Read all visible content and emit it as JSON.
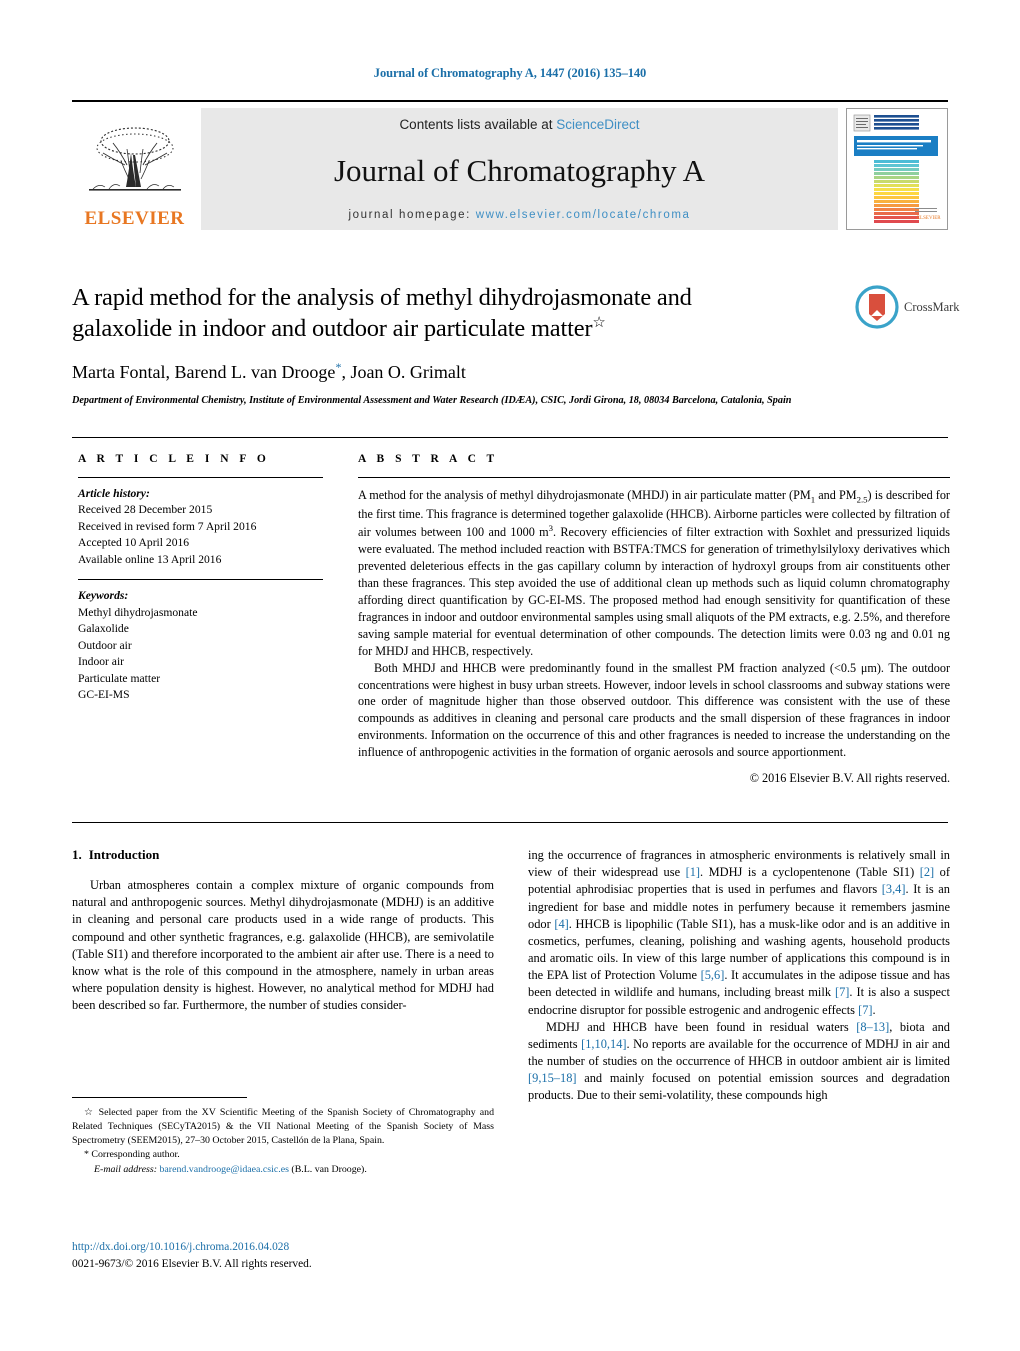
{
  "running_head": "Journal of Chromatography A, 1447 (2016) 135–140",
  "masthead": {
    "contents_prefix": "Contents lists available at ",
    "contents_link": "ScienceDirect",
    "journal_title": "Journal of Chromatography A",
    "homepage_prefix": "journal homepage:",
    "homepage_url": "www.elsevier.com/locate/chroma",
    "publisher": "ELSEVIER",
    "cover_title": "JOURNAL OF CHROMATOGRAPHY A",
    "accent_blue": "#1b6fa8",
    "link_blue": "#3f8fc4",
    "elsevier_orange": "#e87722"
  },
  "article": {
    "title": "A rapid method for the analysis of methyl dihydrojasmonate and galaxolide in indoor and outdoor air particulate matter",
    "title_marker": "☆",
    "authors_pre": "Marta Fontal, Barend L. van Drooge",
    "authors_marker": "*",
    "authors_post": ", Joan O. Grimalt",
    "affiliation": "Department of Environmental Chemistry, Institute of Environmental Assessment and Water Research (IDÆA), CSIC, Jordi Girona, 18, 08034 Barcelona, Catalonia, Spain",
    "crossmark_label": "CrossMark"
  },
  "article_info": {
    "heading": "A R T I C L E  I N F O",
    "history_label": "Article history:",
    "history": [
      "Received 28 December 2015",
      "Received in revised form 7 April 2016",
      "Accepted 10 April 2016",
      "Available online 13 April 2016"
    ],
    "keywords_label": "Keywords:",
    "keywords": [
      "Methyl dihydrojasmonate",
      "Galaxolide",
      "Outdoor air",
      "Indoor air",
      "Particulate matter",
      "GC-EI-MS"
    ]
  },
  "abstract": {
    "heading": "A B S T R A C T",
    "paragraph1_a": "A method for the analysis of methyl dihydrojasmonate (MHDJ) in air particulate matter (PM",
    "paragraph1_sub1": "1",
    "paragraph1_b": " and PM",
    "paragraph1_sub2": "2.5",
    "paragraph1_c": ") is described for the first time. This fragrance is determined together galaxolide (HHCB). Airborne particles were collected by filtration of air volumes between 100 and 1000 m",
    "paragraph1_sup": "3",
    "paragraph1_d": ". Recovery efficiencies of filter extraction with Soxhlet and pressurized liquids were evaluated. The method included reaction with BSTFA:TMCS for generation of trimethylsilyloxy derivatives which prevented deleterious effects in the gas capillary column by interaction of hydroxyl groups from air constituents other than these fragrances. This step avoided the use of additional clean up methods such as liquid column chromatography affording direct quantification by GC-EI-MS. The proposed method had enough sensitivity for quantification of these fragrances in indoor and outdoor environmental samples using small aliquots of the PM extracts, e.g. 2.5%, and therefore saving sample material for eventual determination of other compounds. The detection limits were 0.03 ng and 0.01 ng for MHDJ and HHCB, respectively.",
    "paragraph2_a": "Both MHDJ and HHCB were predominantly found in the smallest PM fraction analyzed (<0.5 ",
    "paragraph2_mu": "μm",
    "paragraph2_b": "). The outdoor concentrations were highest in busy urban streets. However, indoor levels in school classrooms and subway stations were one order of magnitude higher than those observed outdoor. This difference was consistent with the use of these compounds as additives in cleaning and personal care products and the small dispersion of these fragrances in indoor environments. Information on the occurrence of this and other fragrances is needed to increase the understanding on the influence of anthropogenic activities in the formation of organic aerosols and source apportionment.",
    "copyright": "© 2016 Elsevier B.V. All rights reserved."
  },
  "introduction": {
    "number": "1.",
    "heading": "Introduction",
    "left_paragraph": "Urban atmospheres contain a complex mixture of organic compounds from natural and anthropogenic sources. Methyl dihydrojasmonate (MDHJ) is an additive in cleaning and personal care products used in a wide range of products. This compound and other synthetic fragrances, e.g. galaxolide (HHCB), are semivolatile (Table SI1) and therefore incorporated to the ambient air after use. There is a need to know what is the role of this compound in the atmosphere, namely in urban areas where population density is highest. However, no analytical method for MDHJ had been described so far. Furthermore, the number of studies consider-",
    "right_p1_a": "ing the occurrence of fragrances in atmospheric environments is relatively small in view of their widespread use ",
    "right_p1_r1": "[1]",
    "right_p1_b": ". MDHJ is a cyclopentenone (Table SI1) ",
    "right_p1_r2": "[2]",
    "right_p1_c": " of potential aphrodisiac properties that is used in perfumes and flavors ",
    "right_p1_r3": "[3,4]",
    "right_p1_d": ". It is an ingredient for base and middle notes in perfumery because it remembers jasmine odor ",
    "right_p1_r4": "[4]",
    "right_p1_e": ". HHCB is lipophilic (Table SI1), has a musk-like odor and is an additive in cosmetics, perfumes, cleaning, polishing and washing agents, household products and aromatic oils. In view of this large number of applications this compound is in the EPA list of Protection Volume ",
    "right_p1_r5": "[5,6]",
    "right_p1_f": ". It accumulates in the adipose tissue and has been detected in wildlife and humans, including breast milk ",
    "right_p1_r6": "[7]",
    "right_p1_g": ". It is also a suspect endocrine disruptor for possible estrogenic and androgenic effects ",
    "right_p1_r7": "[7]",
    "right_p1_h": ".",
    "right_p2_a": "MDHJ and HHCB have been found in residual waters ",
    "right_p2_r1": "[8–13]",
    "right_p2_b": ", biota and sediments ",
    "right_p2_r2": "[1,10,14]",
    "right_p2_c": ". No reports are available for the occurrence of MDHJ in air and the number of studies on the occurrence of HHCB in outdoor ambient air is limited ",
    "right_p2_r3": "[9,15–18]",
    "right_p2_d": " and mainly focused on potential emission sources and degradation products. Due to their semi-volatility, these compounds high"
  },
  "footnotes": {
    "marker": "☆",
    "conference_note": " Selected paper from the XV Scientific Meeting of the Spanish Society of Chromatography and Related Techniques (SECyTA2015) & the VII National Meeting of the Spanish Society of Mass Spectrometry (SEEM2015), 27–30 October 2015, Castellón de la Plana, Spain.",
    "corresponding_marker": "*",
    "corresponding_text": " Corresponding author.",
    "email_label": "E-mail address:",
    "email": "barend.vandrooge@idaea.csic.es",
    "email_suffix": " (B.L. van Drooge).",
    "doi": "http://dx.doi.org/10.1016/j.chroma.2016.04.028",
    "issn_line": "0021-9673/© 2016 Elsevier B.V. All rights reserved."
  }
}
